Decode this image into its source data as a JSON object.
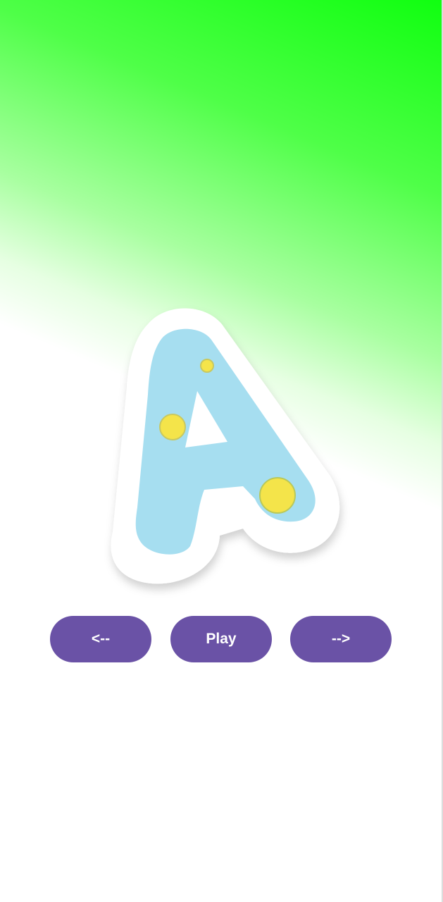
{
  "background": {
    "accent_top": "#10ff10",
    "accent_bottom": "#ffffff"
  },
  "letter_card": {
    "icon": "letter-a-icon",
    "letter_color": "#a6def0",
    "border_color": "#ffffff",
    "dot_color": "#f4e44a"
  },
  "controls": {
    "prev_label": "<--",
    "play_label": "Play",
    "next_label": "-->",
    "button_color": "#6a52a6",
    "label_color": "#ffffff"
  }
}
